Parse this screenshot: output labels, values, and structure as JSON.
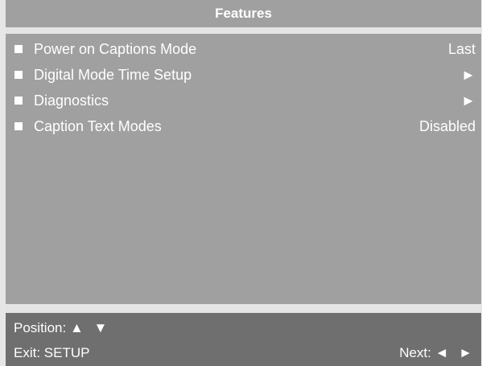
{
  "title": "Features",
  "menu": {
    "items": [
      {
        "label": "Power on Captions Mode",
        "value": "Last"
      },
      {
        "label": "Digital Mode Time Setup",
        "value": "►"
      },
      {
        "label": "Diagnostics",
        "value": "►"
      },
      {
        "label": "Caption Text Modes",
        "value": "Disabled"
      }
    ]
  },
  "footer": {
    "position_label": "Position:",
    "position_keys": "▲ ▼",
    "exit_label": "Exit: SETUP",
    "next_label": "Next:",
    "next_keys": "◄ ►"
  },
  "colors": {
    "panel": "#a0a0a0",
    "separator": "#e4e4e4",
    "footer": "#6f6f6f",
    "text": "#ffffff"
  }
}
